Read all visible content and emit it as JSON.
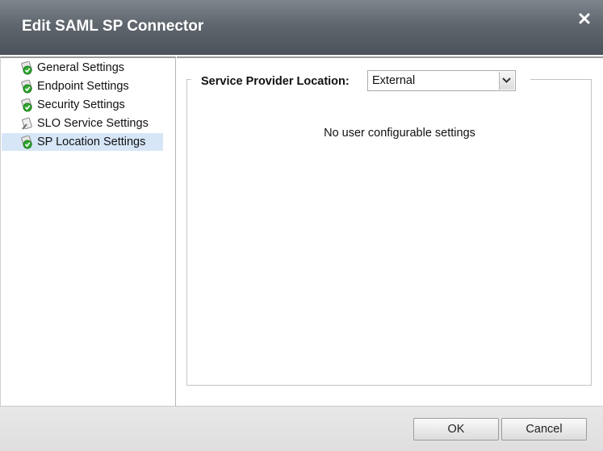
{
  "dialog": {
    "title": "Edit SAML SP Connector",
    "close_icon": "close-icon"
  },
  "nav": {
    "items": [
      {
        "label": "General Settings",
        "icon": "check-settings-icon",
        "selected": false
      },
      {
        "label": "Endpoint Settings",
        "icon": "check-settings-icon",
        "selected": false
      },
      {
        "label": "Security Settings",
        "icon": "check-settings-icon",
        "selected": false
      },
      {
        "label": "SLO Service Settings",
        "icon": "settings-icon",
        "selected": false
      },
      {
        "label": "SP Location Settings",
        "icon": "check-settings-icon",
        "selected": true
      }
    ]
  },
  "main": {
    "location_label": "Service Provider Location:",
    "location_value": "External",
    "message": "No user configurable settings"
  },
  "footer": {
    "ok_label": "OK",
    "cancel_label": "Cancel"
  },
  "colors": {
    "titlebar": "#5f666e",
    "selected_bg": "#d6e6f7",
    "check_green": "#2fa82f"
  }
}
